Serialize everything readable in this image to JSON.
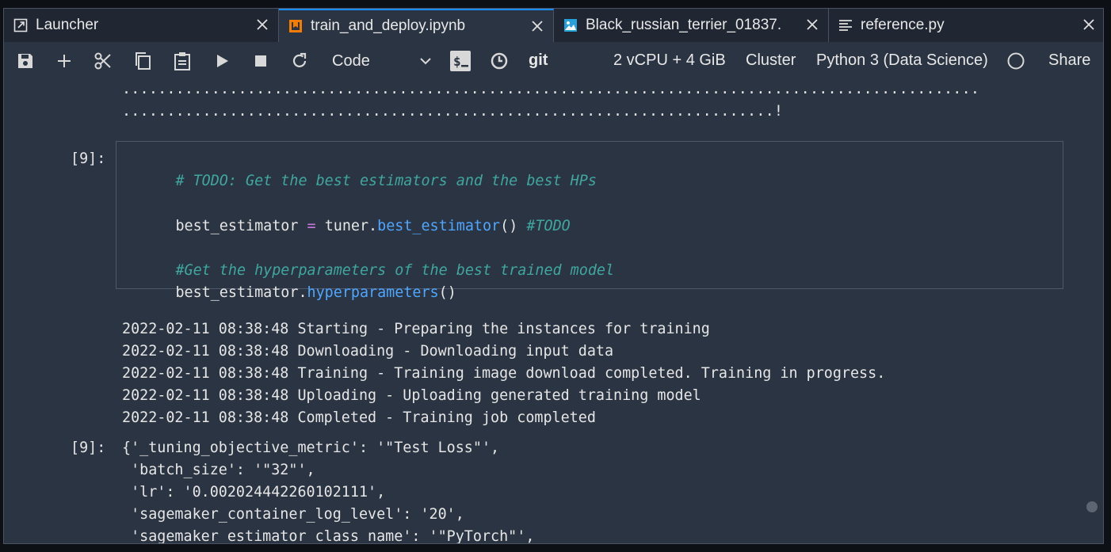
{
  "tabs": [
    {
      "label": "Launcher",
      "icon": "launcher-icon",
      "active": false
    },
    {
      "label": "train_and_deploy.ipynb",
      "icon": "notebook-icon",
      "active": true
    },
    {
      "label": "Black_russian_terrier_01837.",
      "icon": "image-file-icon",
      "active": false
    },
    {
      "label": "reference.py",
      "icon": "text-file-icon",
      "active": false
    }
  ],
  "toolbar": {
    "cell_type": "Code",
    "git_label": "git",
    "instance": "2 vCPU + 4 GiB",
    "cluster": "Cluster",
    "kernel": "Python 3 (Data Science)",
    "share": "Share"
  },
  "notebook": {
    "dots_line1": "................................................................................................",
    "dots_line2": ".........................................................................!",
    "cell_prompt_in": "[9]:",
    "code": {
      "line1_comment": "# TODO: Get the best estimators and the best HPs",
      "line2_var": "best_estimator",
      "line2_eq": "=",
      "line2_obj": "tuner.",
      "line2_fn": "best_estimator",
      "line2_call": "()",
      "line2_comment": "#TODO",
      "line3_comment": "#Get the hyperparameters of the best trained model",
      "line4_obj": "best_estimator.",
      "line4_fn": "hyperparameters",
      "line4_call": "()"
    },
    "logs": [
      "2022-02-11 08:38:48 Starting - Preparing the instances for training",
      "2022-02-11 08:38:48 Downloading - Downloading input data",
      "2022-02-11 08:38:48 Training - Training image download completed. Training in progress.",
      "2022-02-11 08:38:48 Uploading - Uploading generated training model",
      "2022-02-11 08:38:48 Completed - Training job completed"
    ],
    "cell_prompt_out": "[9]:",
    "output": [
      "{'_tuning_objective_metric': '\"Test Loss\"',",
      " 'batch_size': '\"32\"',",
      " 'lr': '0.002024442260102111',",
      " 'sagemaker_container_log_level': '20',",
      " 'sagemaker_estimator_class_name': '\"PyTorch\"',"
    ]
  },
  "colors": {
    "background": "#2b3442",
    "accent": "#1a8cff",
    "comment": "#3fa7a0",
    "function": "#4fa6ff",
    "operator": "#c678dd"
  }
}
